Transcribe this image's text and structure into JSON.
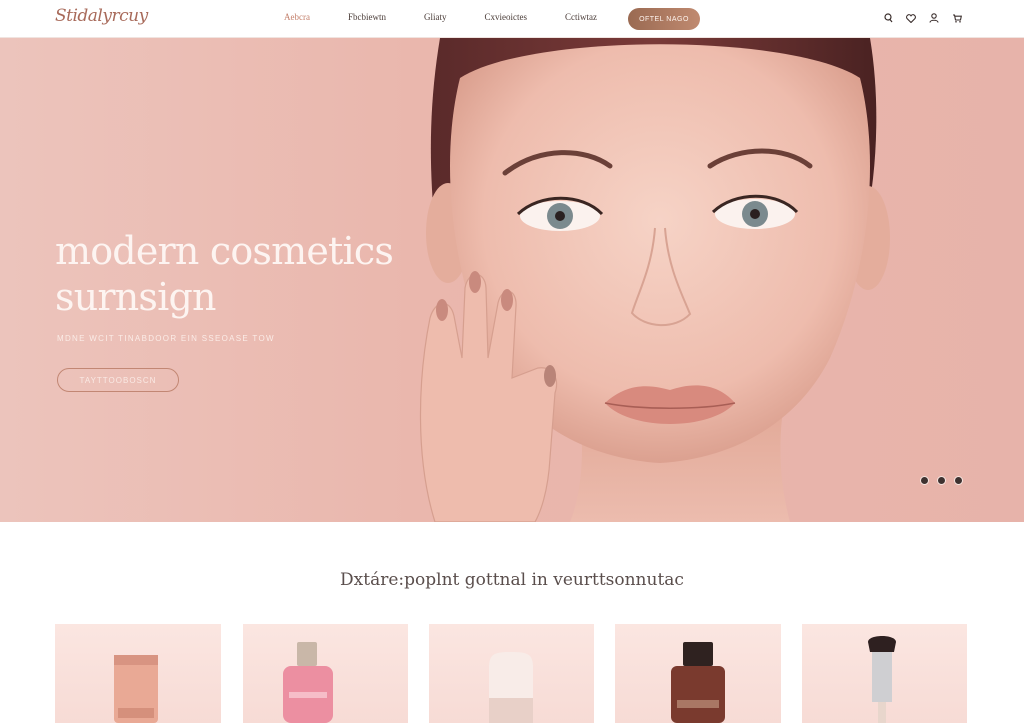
{
  "nav": {
    "logo": "Stidalyrcuy",
    "links": [
      "Aebcra",
      "Fbcbiewtn",
      "Gliaty",
      "Cxvieoictes",
      "Cctiwtaz"
    ],
    "cta_label": "OFTEL NAGO",
    "icons": [
      "search-icon",
      "heart-icon",
      "user-icon",
      "cart-icon"
    ]
  },
  "hero": {
    "title_line1": "modern cosmetics",
    "title_line2": "surnsign",
    "subtitle": "MDNE WCIT TINABDOOR EIN SSEOASE TOW",
    "button_label": "TAYTTOOBOSCN",
    "slides_total": 3,
    "slide_active": 1
  },
  "section": {
    "title": "Dxtáre:poplnt gottnal in veurttsonnutac"
  },
  "colors": {
    "accent": "#c08a70",
    "hero_bg": "#eab7ad",
    "card_bg": "#fbe6e1"
  }
}
